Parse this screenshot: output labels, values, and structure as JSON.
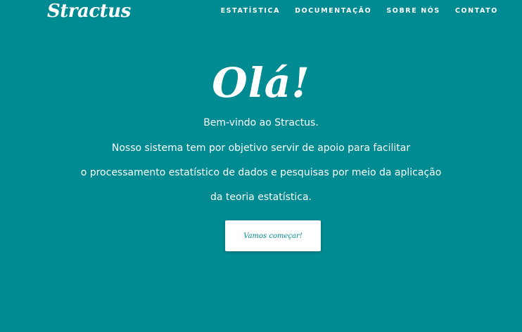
{
  "brand": {
    "name": "Stractus"
  },
  "nav": {
    "items": [
      {
        "label": "ESTATÍSTICA"
      },
      {
        "label": "DOCUMENTAÇÃO"
      },
      {
        "label": "SOBRE NÓS"
      },
      {
        "label": "CONTATO"
      }
    ]
  },
  "hero": {
    "title": "Olá!",
    "lines": [
      "Bem-vindo ao Stractus.",
      "Nosso sistema tem por objetivo servir de apoio para facilitar",
      "o processamento estatístico de dados e pesquisas por meio da aplicação",
      "da teoria estatística."
    ],
    "cta_label": "Vamos começar!"
  },
  "colors": {
    "background": "#008a91",
    "text": "#ffffff",
    "button_background": "#ffffff",
    "button_text": "#008a91"
  }
}
